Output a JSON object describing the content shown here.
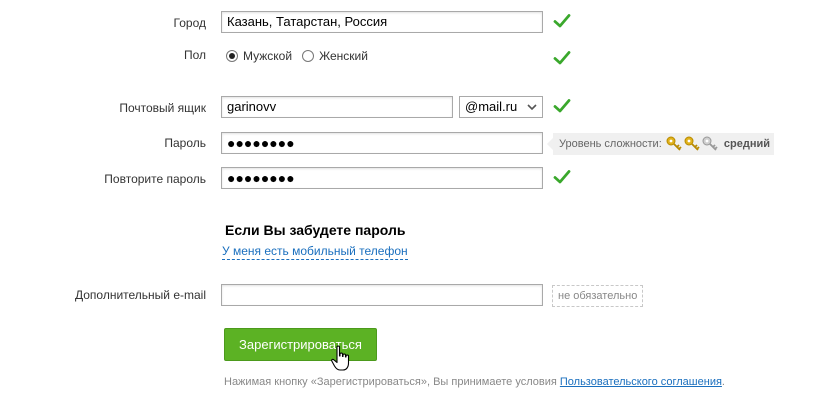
{
  "form": {
    "city": {
      "label": "Город",
      "value": "Казань, Татарстан, Россия"
    },
    "gender": {
      "label": "Пол",
      "male": "Мужской",
      "female": "Женский",
      "selected": "male"
    },
    "mailbox": {
      "label": "Почтовый ящик",
      "value": "garinovv",
      "domain": "@mail.ru"
    },
    "password": {
      "label": "Пароль",
      "value": "●●●●●●●●",
      "strength_label": "Уровень сложности:",
      "strength_value": "средний",
      "strength_keys_active": 2,
      "strength_keys_total": 3
    },
    "password_repeat": {
      "label": "Повторите пароль",
      "value": "●●●●●●●●"
    },
    "recovery": {
      "title": "Если Вы забудете пароль",
      "phone_link": "У меня есть мобильный телефон"
    },
    "extra_email": {
      "label": "Дополнительный e-mail",
      "value": "",
      "hint": "не обязательно"
    },
    "submit_label": "Зарегистрироваться",
    "terms": {
      "prefix": "Нажимая кнопку «Зарегистрироваться», Вы принимаете условия ",
      "link": "Пользовательского соглашения",
      "suffix": "."
    }
  },
  "colors": {
    "check_green": "#3aa82c",
    "button_green": "#5cb224",
    "link_blue": "#1a6fbe",
    "key_gold": "#e0b21b"
  },
  "icons": [
    "check-icon",
    "chevron-down-icon",
    "key-icon",
    "hand-cursor-icon"
  ]
}
